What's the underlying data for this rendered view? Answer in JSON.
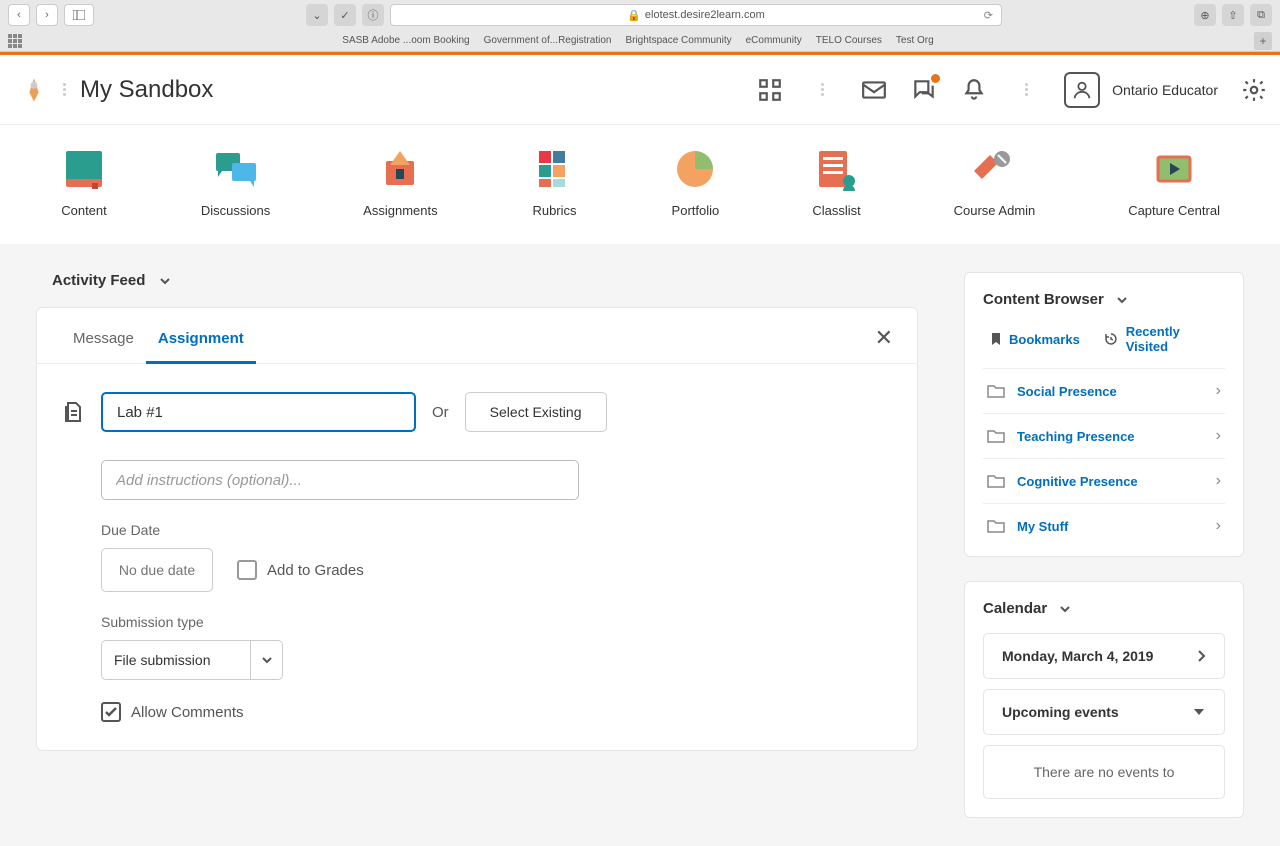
{
  "browser": {
    "url": "elotest.desire2learn.com",
    "bookmarks": [
      "SASB Adobe ...oom Booking",
      "Government of...Registration",
      "Brightspace Community",
      "eCommunity",
      "TELO Courses",
      "Test Org"
    ]
  },
  "header": {
    "course_title": "My Sandbox",
    "user_name": "Ontario Educator"
  },
  "nav": [
    {
      "label": "Content"
    },
    {
      "label": "Discussions"
    },
    {
      "label": "Assignments"
    },
    {
      "label": "Rubrics"
    },
    {
      "label": "Portfolio"
    },
    {
      "label": "Classlist"
    },
    {
      "label": "Course Admin"
    },
    {
      "label": "Capture Central"
    }
  ],
  "activity_feed": {
    "title": "Activity Feed",
    "tabs": {
      "message": "Message",
      "assignment": "Assignment"
    },
    "form": {
      "title_value": "Lab #1",
      "or": "Or",
      "select_existing": "Select Existing",
      "instructions_placeholder": "Add instructions (optional)...",
      "due_date_label": "Due Date",
      "due_date_placeholder": "No due date",
      "add_to_grades": "Add to Grades",
      "submission_type_label": "Submission type",
      "submission_value": "File submission",
      "allow_comments": "Allow Comments"
    }
  },
  "content_browser": {
    "title": "Content Browser",
    "bookmarks": "Bookmarks",
    "recently_visited": "Recently Visited",
    "folders": [
      {
        "label": "Social Presence"
      },
      {
        "label": "Teaching Presence"
      },
      {
        "label": "Cognitive Presence"
      },
      {
        "label": "My Stuff"
      }
    ]
  },
  "calendar": {
    "title": "Calendar",
    "date": "Monday, March 4, 2019",
    "upcoming": "Upcoming events",
    "no_events": "There are no events to"
  }
}
